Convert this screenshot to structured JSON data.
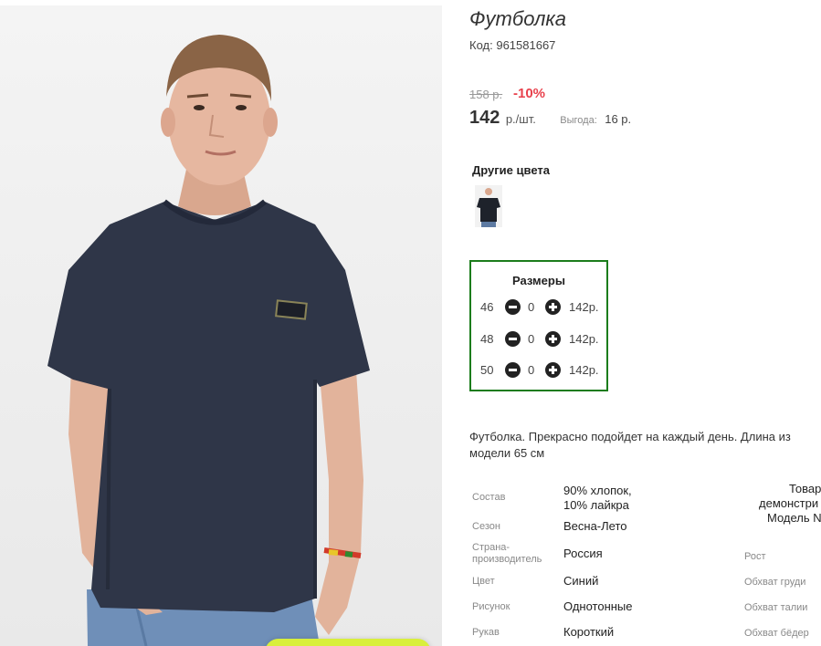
{
  "product": {
    "title": "Футболка",
    "code_label": "Код:",
    "code_value": "961581667",
    "old_price": "158 р.",
    "discount": "-10%",
    "price": "142",
    "price_unit": "р./шт.",
    "benefit_label": "Выгода:",
    "benefit_value": "16 р."
  },
  "other_colors": {
    "heading": "Другие цвета"
  },
  "sizes": {
    "heading": "Размеры",
    "rows": [
      {
        "size": "46",
        "qty": "0",
        "price": "142р."
      },
      {
        "size": "48",
        "qty": "0",
        "price": "142р."
      },
      {
        "size": "50",
        "qty": "0",
        "price": "142р."
      }
    ]
  },
  "description": "Футболка. Прекрасно подойдет на каждый день. Длина из… модели 65 см",
  "description_lines": [
    "Футболка. Прекрасно подойдет на каждый день. Длина из",
    "модели 65 см"
  ],
  "specs": [
    {
      "label": "Состав",
      "value_lines": [
        "90% хлопок,",
        "10% лайкра"
      ]
    },
    {
      "label": "Сезон",
      "value_lines": [
        "Весна-Лето"
      ]
    },
    {
      "label_lines": [
        "Страна-",
        "производитель"
      ],
      "value_lines": [
        "Россия"
      ]
    },
    {
      "label": "Цвет",
      "value_lines": [
        "Синий"
      ]
    },
    {
      "label": "Рисунок",
      "value_lines": [
        "Однотонные"
      ]
    },
    {
      "label": "Рукав",
      "value_lines": [
        "Короткий"
      ]
    }
  ],
  "model_params": {
    "heading_lines": [
      "Товар",
      "демонстри",
      "Модель N"
    ],
    "labels": [
      "Рост",
      "Обхват груди",
      "Обхват талии",
      "Обхват бёдер"
    ]
  },
  "colors": {
    "discount_red": "#e8414c",
    "sizes_border_green": "#1b7c1b",
    "shirt_navy": "#2f3648",
    "zoom_button_yellow": "#d9ef3c"
  }
}
